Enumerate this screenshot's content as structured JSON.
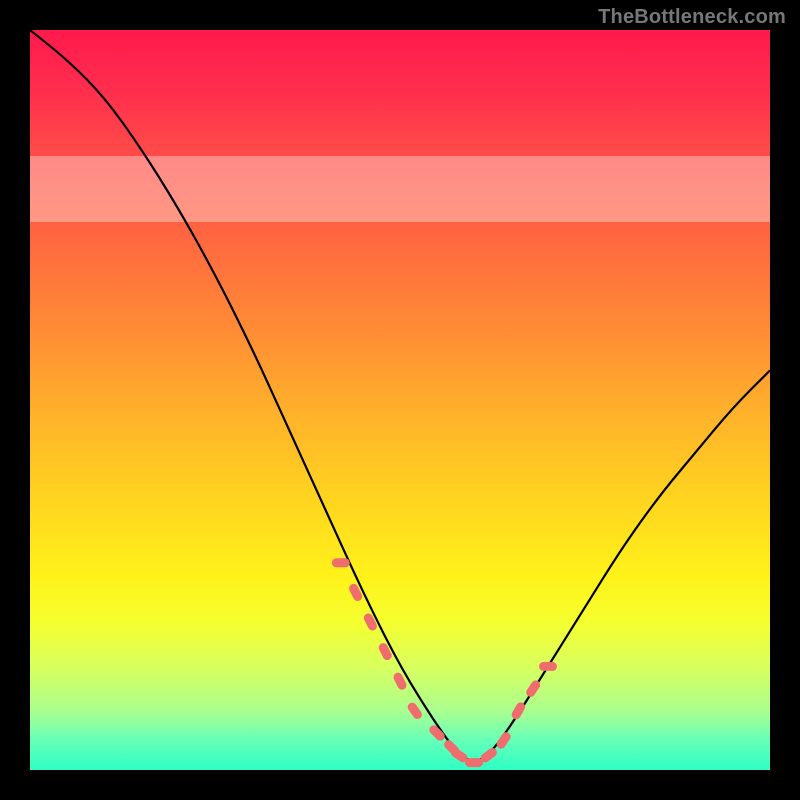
{
  "watermark": "TheBottleneck.com",
  "colors": {
    "background": "#000000",
    "curve": "#000000",
    "marker": "#f06d6d",
    "gradient_top": "#ff1a4d",
    "gradient_bottom": "#2effc5",
    "pale_band": "rgba(255,255,255,0.35)"
  },
  "chart_data": {
    "type": "line",
    "title": "",
    "xlabel": "",
    "ylabel": "",
    "xlim": [
      0,
      100
    ],
    "ylim": [
      0,
      100
    ],
    "series": [
      {
        "name": "bottleneck-curve",
        "x": [
          0,
          5,
          10,
          15,
          20,
          25,
          30,
          35,
          40,
          45,
          50,
          55,
          58,
          60,
          62,
          65,
          70,
          75,
          80,
          85,
          90,
          95,
          100
        ],
        "values": [
          100,
          96,
          91,
          84,
          76,
          67,
          57,
          46,
          35,
          24,
          14,
          6,
          2,
          1,
          2,
          6,
          14,
          22,
          30,
          37,
          43,
          49,
          54
        ]
      }
    ],
    "markers": {
      "name": "highlight-dots",
      "x": [
        42,
        44,
        46,
        48,
        50,
        52,
        55,
        57,
        58,
        60,
        62,
        64,
        66,
        68,
        70
      ],
      "values": [
        28,
        24,
        20,
        16,
        12,
        8,
        5,
        3,
        2,
        1,
        2,
        4,
        8,
        11,
        14
      ]
    },
    "bands": [
      {
        "y_start": 74,
        "y_end": 83
      }
    ]
  }
}
